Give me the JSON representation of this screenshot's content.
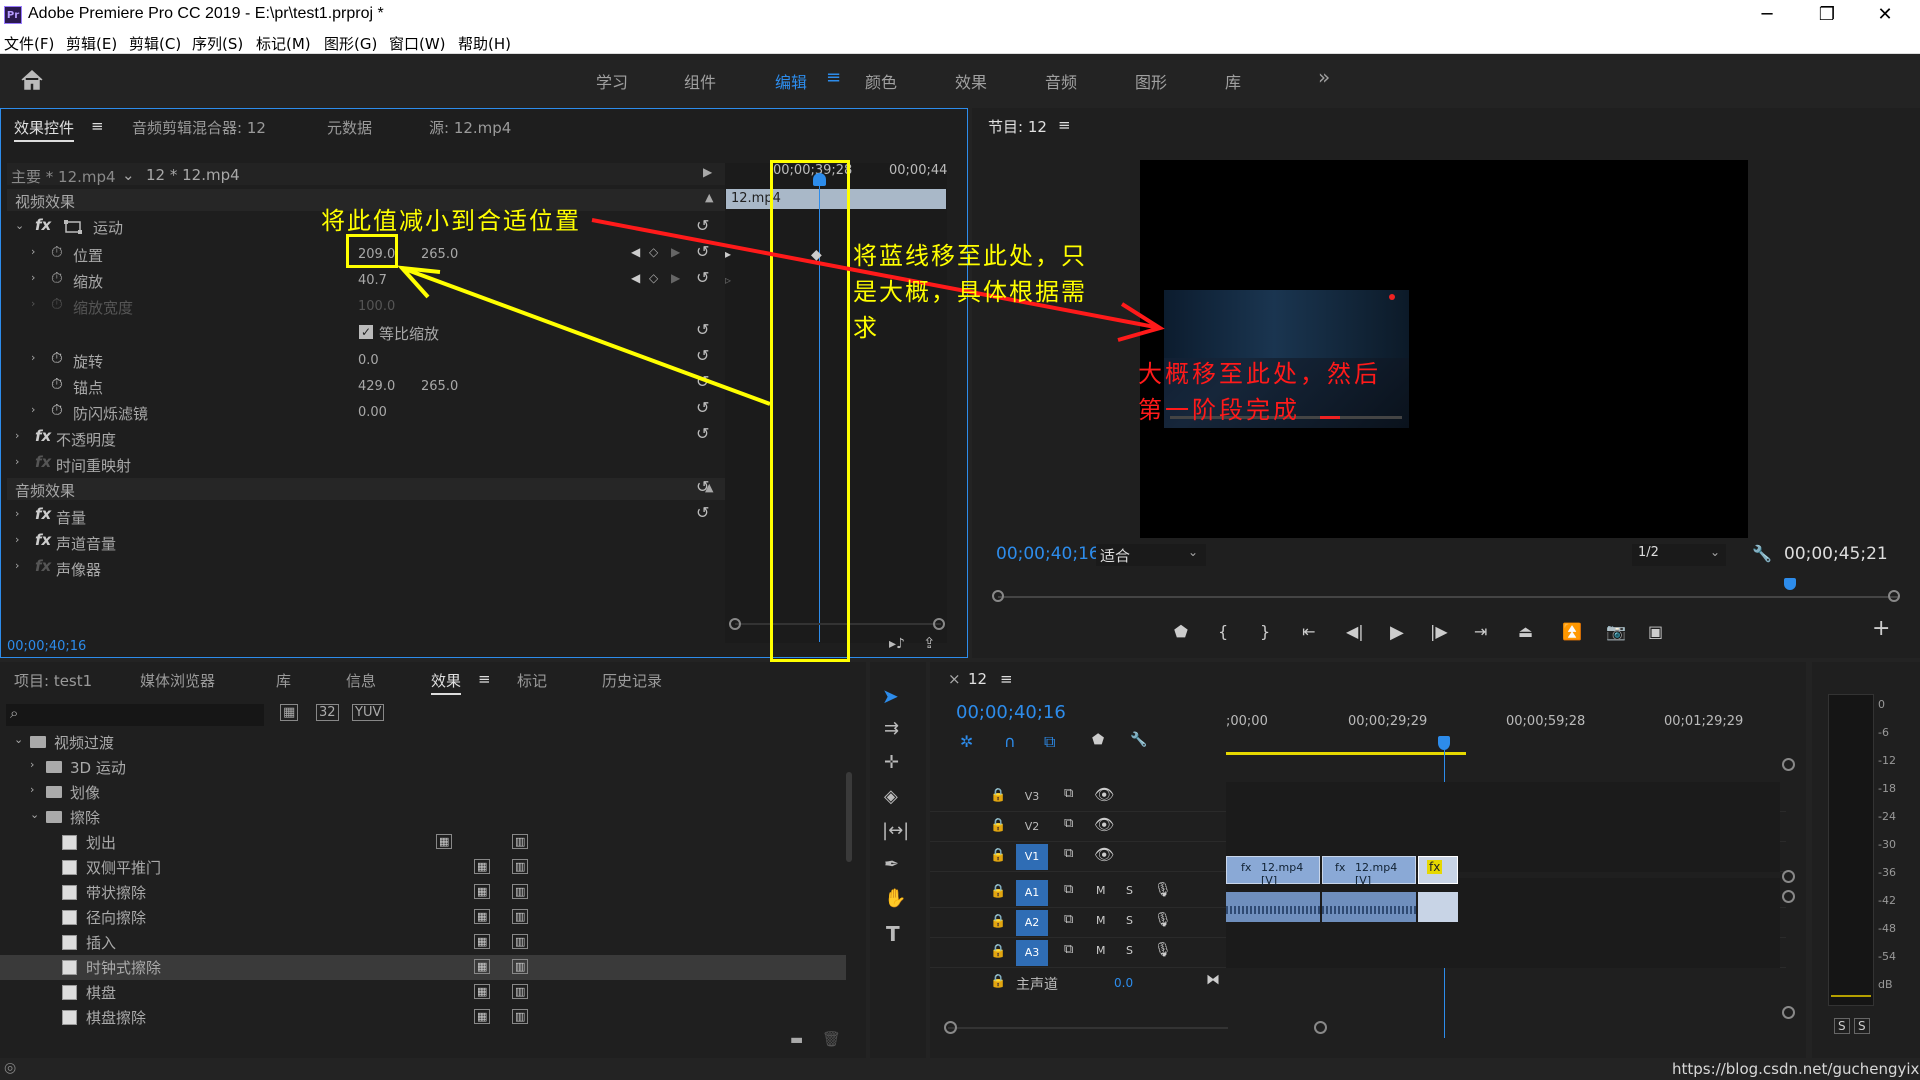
{
  "window": {
    "title": "Adobe Premiere Pro CC 2019 - E:\\pr\\test1.prproj *",
    "logo": "Pr",
    "controls": {
      "minimize": "─",
      "restore": "❐",
      "close": "✕"
    }
  },
  "menu": [
    "文件(F)",
    "剪辑(E)",
    "剪辑(C)",
    "序列(S)",
    "标记(M)",
    "图形(G)",
    "窗口(W)",
    "帮助(H)"
  ],
  "workspaces": {
    "items": [
      "学习",
      "组件",
      "编辑",
      "颜色",
      "效果",
      "音频",
      "图形",
      "库"
    ],
    "active": "编辑",
    "more": "»"
  },
  "effect_controls": {
    "tabs": [
      "效果控件",
      "音频剪辑混合器: 12",
      "元数据",
      "源: 12.mp4"
    ],
    "master": "主要 * 12.mp4",
    "clip": "12 * 12.mp4",
    "video_effects_header": "视频效果",
    "motion": "运动",
    "position_label": "位置",
    "position_x": "209.0",
    "position_y": "265.0",
    "scale_label": "缩放",
    "scale_value": "40.7",
    "scale_width_label": "缩放宽度",
    "scale_width_value": "100.0",
    "uniform_scale_label": "等比缩放",
    "rotation_label": "旋转",
    "rotation_value": "0.0",
    "anchor_label": "锚点",
    "anchor_x": "429.0",
    "anchor_y": "265.0",
    "antiflicker_label": "防闪烁滤镜",
    "antiflicker_value": "0.00",
    "opacity_label": "不透明度",
    "time_remap_label": "时间重映射",
    "audio_effects_header": "音频效果",
    "volume_label": "音量",
    "channel_volume_label": "声道音量",
    "panner_label": "声像器",
    "timecode": "00;00;40;16",
    "mini_timeline": {
      "time_left": "00;00;39;28",
      "time_right": "00;00;44",
      "clip_label": "12.mp4"
    }
  },
  "program_monitor": {
    "title": "节目: 12",
    "timecode_current": "00;00;40;16",
    "fit": "适合",
    "resolution": "1/2",
    "timecode_duration": "00;00;45;21"
  },
  "project_panel": {
    "tabs": [
      "项目: test1",
      "媒体浏览器",
      "库",
      "信息",
      "效果",
      "标记",
      "历史记录"
    ],
    "active_tab": "效果",
    "search_placeholder": "",
    "tree": [
      {
        "label": "视频过渡",
        "level": 0,
        "type": "folder",
        "expanded": true
      },
      {
        "label": "3D 运动",
        "level": 1,
        "type": "folder",
        "expanded": false
      },
      {
        "label": "划像",
        "level": 1,
        "type": "folder",
        "expanded": false
      },
      {
        "label": "擦除",
        "level": 1,
        "type": "folder",
        "expanded": true
      },
      {
        "label": "划出",
        "level": 2,
        "type": "effect"
      },
      {
        "label": "双侧平推门",
        "level": 2,
        "type": "effect"
      },
      {
        "label": "带状擦除",
        "level": 2,
        "type": "effect"
      },
      {
        "label": "径向擦除",
        "level": 2,
        "type": "effect"
      },
      {
        "label": "插入",
        "level": 2,
        "type": "effect"
      },
      {
        "label": "时钟式擦除",
        "level": 2,
        "type": "effect",
        "selected": true
      },
      {
        "label": "棋盘",
        "level": 2,
        "type": "effect"
      },
      {
        "label": "棋盘擦除",
        "level": 2,
        "type": "effect"
      }
    ]
  },
  "timeline": {
    "sequence": "12",
    "timecode": "00;00;40;16",
    "ruler": [
      ";00;00",
      "00;00;29;29",
      "00;00;59;28",
      "00;01;29;29"
    ],
    "tracks": {
      "video": [
        "V3",
        "V2",
        "V1"
      ],
      "audio": [
        "A1",
        "A2",
        "A3"
      ],
      "mute": "M",
      "solo": "S",
      "master_label": "主声道",
      "master_value": "0.0"
    },
    "clips": [
      "12.mp4 [V]",
      "12.mp4 [V]"
    ]
  },
  "audio_meter": {
    "labels": [
      "0",
      "-6",
      "-12",
      "-18",
      "-24",
      "-30",
      "-36",
      "-42",
      "-48",
      "-54",
      "dB"
    ],
    "solo": [
      "S",
      "S"
    ]
  },
  "annotations": {
    "yellow": "将此值减小到合适位置",
    "yellow2_line1": "将蓝线移至此处，只",
    "yellow2_line2": "是大概，具体根据需",
    "yellow2_line3": "求",
    "red_line1": "大概移至此处，然后",
    "red_line2": "第一阶段完成"
  },
  "watermark": "https://blog.csdn.net/guchengyixin",
  "colors": {
    "accent": "#2d8ceb",
    "annotation_yellow": "#ffff00",
    "annotation_red": "#ff1a1a"
  }
}
